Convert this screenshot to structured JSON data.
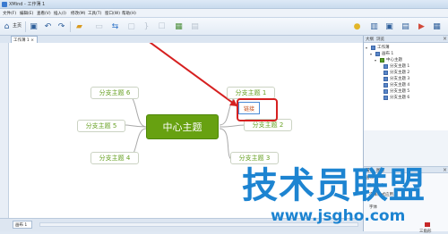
{
  "window": {
    "title": "XMind - 工作薄 1"
  },
  "menu": [
    "文件(F)",
    "编辑(E)",
    "查看(V)",
    "插入(I)",
    "修改(M)",
    "工具(T)",
    "窗口(W)",
    "帮助(H)"
  ],
  "toolbar": {
    "home_label": "主页"
  },
  "editor": {
    "tab_label": "工作薄 1",
    "sheet_tab": "画布 1"
  },
  "map": {
    "center": "中心主题",
    "topics": [
      "分支主题 1",
      "分支主题 2",
      "分支主题 3",
      "分支主题 4",
      "分支主题 5",
      "分支主题 6"
    ],
    "marker_label": "链接"
  },
  "outline_panel": {
    "tabs": [
      "大纲",
      "浏览"
    ],
    "tree": [
      {
        "label": "工作薄",
        "level": 0
      },
      {
        "label": "画布 1",
        "level": 1
      },
      {
        "label": "中心主题",
        "level": 2
      },
      {
        "label": "分支主题 1",
        "level": 3
      },
      {
        "label": "分支主题 2",
        "level": 3
      },
      {
        "label": "分支主题 3",
        "level": 3
      },
      {
        "label": "分支主题 4",
        "level": 3
      },
      {
        "label": "分支主题 5",
        "level": 3
      },
      {
        "label": "分支主题 6",
        "level": 3
      }
    ]
  },
  "properties_panel": {
    "tabs": [
      "属性",
      "图标"
    ],
    "section": "画布",
    "group_label": "画布样式",
    "style_select": "选择样式应用...",
    "font_label": "字体",
    "structure_label": "三角形"
  },
  "watermark": {
    "brand": "技术员联盟",
    "url": "www.jsgho.com"
  },
  "colors": {
    "topic_green": "#67a111",
    "annotation_red": "#d62020",
    "watermark_blue": "#1d84d1"
  }
}
